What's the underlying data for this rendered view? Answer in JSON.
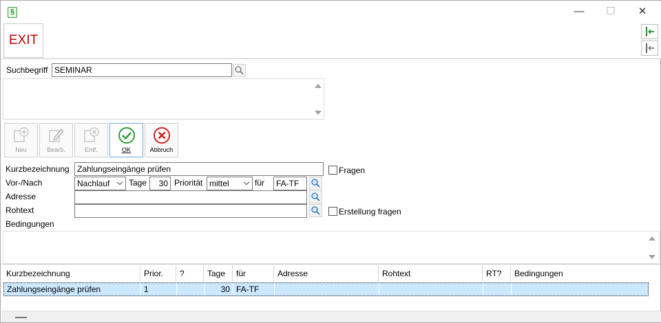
{
  "window": {
    "app_icon": "§",
    "minimize": "—",
    "maximize": "☐",
    "close": "✕"
  },
  "toolbar": {
    "exit_label": "EXIT"
  },
  "search": {
    "label": "Suchbegriff",
    "value": "SEMINAR"
  },
  "actions": {
    "new": "Neu",
    "edit": "Bearb.",
    "remove": "Entf.",
    "ok": "OK",
    "cancel": "Abbruch"
  },
  "form": {
    "short_label": "Kurzbezeichnung",
    "short_value": "Zahlungseingänge prüfen",
    "ask_label": "Fragen",
    "ask_checked": false,
    "timing_label": "Vor-/Nach",
    "timing_value": "Nachlauf",
    "days_label": "Tage",
    "days_value": "30",
    "priority_label": "Priorität",
    "priority_value": "mittel",
    "for_label": "für",
    "for_value": "FA-TF",
    "address_label": "Adresse",
    "address_value": "",
    "rawtext_label": "Rohtext",
    "rawtext_value": "",
    "create_ask_label": "Erstellung fragen",
    "create_ask_checked": false,
    "conditions_label": "Bedingungen"
  },
  "table": {
    "columns": [
      "Kurzbezeichnung",
      "Prior.",
      "?",
      "Tage",
      "für",
      "Adresse",
      "Rohtext",
      "RT?",
      "Bedingungen"
    ],
    "rows": [
      [
        "Zahlungseingänge prüfen",
        "1",
        "",
        "30",
        "FA-TF",
        "",
        "",
        "",
        ""
      ]
    ]
  },
  "colors": {
    "exit_red": "#c80000",
    "selection_blue": "#cce8ff",
    "ok_green": "#2e9e3e",
    "cancel_red": "#d42020",
    "side_green": "#3a9a3a"
  }
}
